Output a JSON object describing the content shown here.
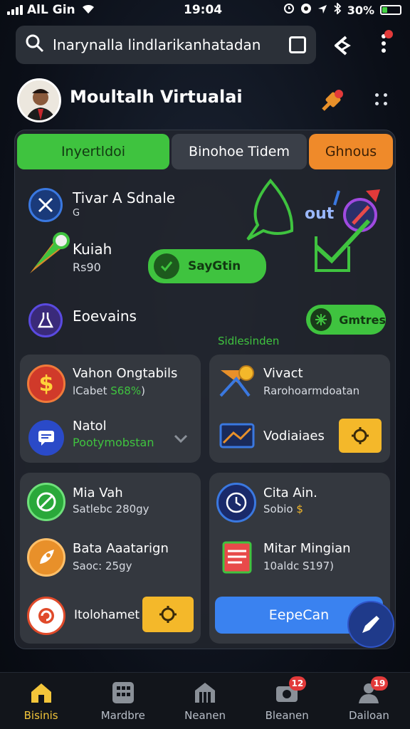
{
  "status": {
    "carrier": "AlL Gin",
    "time": "19:04",
    "battery": "30%",
    "battery_level": 0.3
  },
  "search": {
    "value": "Inarynalla lindlarikanhatadan"
  },
  "header": {
    "title": "Moultalh Virtualai",
    "notification_icon": "pin-alert-icon"
  },
  "tabs": [
    {
      "label": "Inyertldoi",
      "color": "#3fc33f"
    },
    {
      "label": "Binohoe Tidem",
      "color": "#3a3f48"
    },
    {
      "label": "Ghnous",
      "color": "#ef8a2a"
    }
  ],
  "top_section": {
    "item1": {
      "title": "Tivar A Sdnale",
      "sub": "G"
    },
    "item2": {
      "title": "Kuiah",
      "sub": "Rs90"
    },
    "item3": {
      "title": "Eoevains"
    },
    "green_button": "SayGtin",
    "out_label": "out",
    "games_button": "Gmtres",
    "green_caption": "Sidlesinden"
  },
  "cards": {
    "c1": {
      "title": "Vahon Ongtabils",
      "sub_prefix": "lCabet ",
      "sub_value": "S68%",
      "sub_suffix": ")",
      "row2_title": "Natol",
      "row2_sub": "Pootymobstan"
    },
    "c2": {
      "title": "Vivact",
      "sub": "Rarohoarmdoatan",
      "row2_title": "Vodiaiaes"
    },
    "c3": {
      "title": "Mia Vah",
      "sub": "Satlebc 280gy",
      "row2_title": "Bata Aaatarign",
      "row2_sub": "Saoc: 25gy",
      "row3_title": "Itolohamet"
    },
    "c4": {
      "title": "Cita Ain.",
      "sub": "Sobio",
      "sub_value": "$",
      "row2_title": "Mitar Mingian",
      "row2_sub": "10aldc S197)",
      "blue_button": "EepeCan"
    }
  },
  "nav": [
    {
      "label": "Bisinis",
      "active": true,
      "badge": ""
    },
    {
      "label": "Mardbre",
      "active": false,
      "badge": ""
    },
    {
      "label": "Neanen",
      "active": false,
      "badge": ""
    },
    {
      "label": "Bleanen",
      "active": false,
      "badge": "12"
    },
    {
      "label": "Dailoan",
      "active": false,
      "badge": "19"
    }
  ],
  "colors": {
    "accent_green": "#3fc33f",
    "accent_orange": "#ef8a2a",
    "accent_yellow": "#f4b82a",
    "accent_blue": "#3a82f0",
    "badge_red": "#e23a3a"
  }
}
